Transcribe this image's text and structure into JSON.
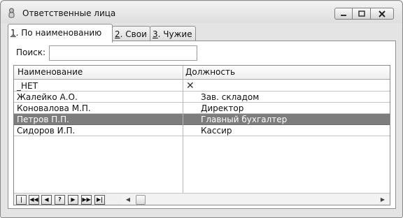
{
  "window": {
    "title": "Ответственные лица"
  },
  "tabs": [
    {
      "key": "1",
      "rest": ". По наименованию"
    },
    {
      "key": "2",
      "rest": ". Свои"
    },
    {
      "key": "3",
      "rest": ". Чужие"
    }
  ],
  "search": {
    "label": "Поиск:",
    "value": ""
  },
  "grid": {
    "columns": [
      "Наименование",
      "Должность"
    ],
    "rows": [
      {
        "name": "_НЕТ",
        "position": ""
      },
      {
        "name": "Жалейко А.О.",
        "position": "Зав. складом"
      },
      {
        "name": "Коновалова М.П.",
        "position": "Директор"
      },
      {
        "name": "Петров П.П.",
        "position": "Главный бухгалтер"
      },
      {
        "name": "Сидоров И.П.",
        "position": "Кассир"
      }
    ],
    "selected_row": 3
  },
  "nav_buttons": [
    "|◀◀",
    "◀◀",
    "◀",
    "?",
    "▶",
    "▶▶",
    "▶|"
  ],
  "colors": {
    "selected_row_bg": "#7d7d7d",
    "selected_row_text": "#ffffff"
  }
}
